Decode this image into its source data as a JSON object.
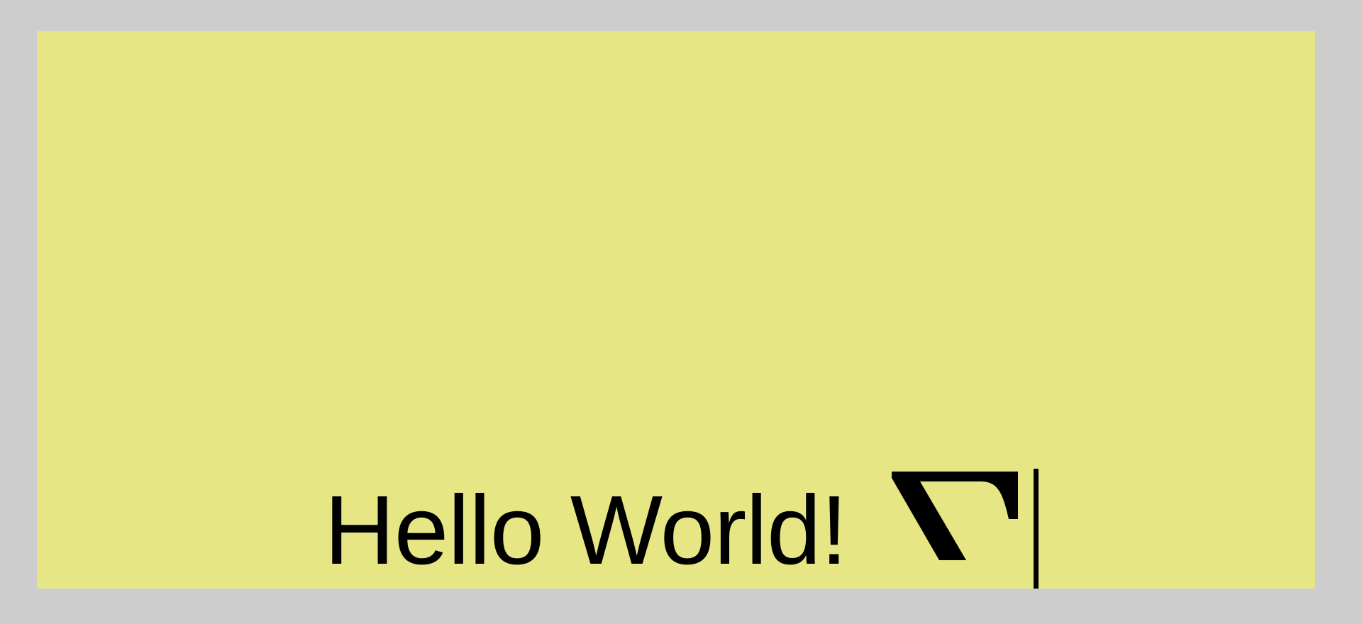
{
  "colors": {
    "background": "#cdcdcd",
    "canvas": "#e6e685",
    "text": "#000000"
  },
  "canvas": {
    "text": "Hello World!"
  },
  "icons": {
    "glyph": "corner-glyph-icon",
    "cursor": "text-cursor-icon"
  }
}
